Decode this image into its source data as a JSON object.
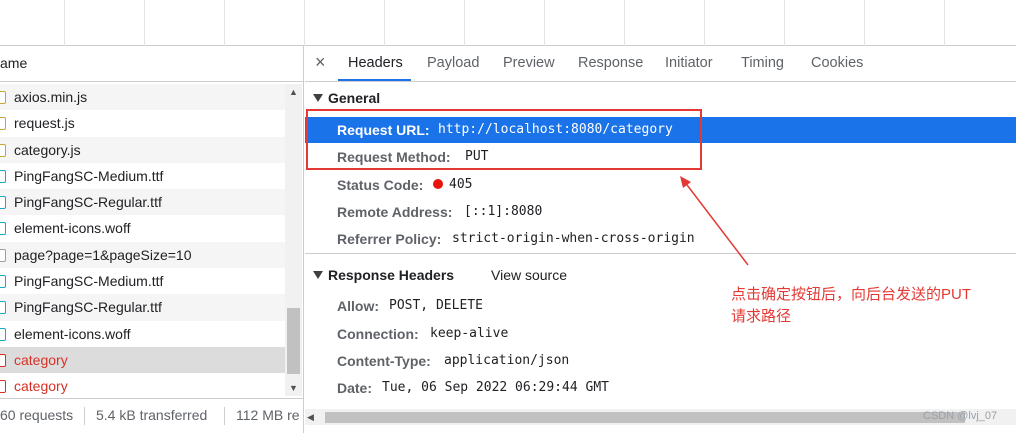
{
  "left": {
    "column_header": "ame",
    "files": [
      {
        "name": "axios.min.js",
        "type": "script",
        "error": false
      },
      {
        "name": "request.js",
        "type": "script",
        "error": false
      },
      {
        "name": "category.js",
        "type": "script",
        "error": false
      },
      {
        "name": "PingFangSC-Medium.ttf",
        "type": "font",
        "error": false
      },
      {
        "name": "PingFangSC-Regular.ttf",
        "type": "font",
        "error": false
      },
      {
        "name": "element-icons.woff",
        "type": "font",
        "error": false
      },
      {
        "name": "page?page=1&pageSize=10",
        "type": "doc",
        "error": false
      },
      {
        "name": "PingFangSC-Medium.ttf",
        "type": "font",
        "error": false
      },
      {
        "name": "PingFangSC-Regular.ttf",
        "type": "font",
        "error": false
      },
      {
        "name": "element-icons.woff",
        "type": "font",
        "error": false
      },
      {
        "name": "category",
        "type": "xhr",
        "error": true
      },
      {
        "name": "category",
        "type": "xhr",
        "error": true
      }
    ],
    "status": {
      "requests": "60 requests",
      "transferred": "5.4 kB transferred",
      "resources": "112 MB re"
    }
  },
  "tabs": [
    {
      "label": "Headers",
      "active": true
    },
    {
      "label": "Payload",
      "active": false
    },
    {
      "label": "Preview",
      "active": false
    },
    {
      "label": "Response",
      "active": false
    },
    {
      "label": "Initiator",
      "active": false
    },
    {
      "label": "Timing",
      "active": false
    },
    {
      "label": "Cookies",
      "active": false
    }
  ],
  "close_symbol": "×",
  "general": {
    "title": "General",
    "request_url_label": "Request URL:",
    "request_url": "http://localhost:8080/category",
    "request_method_label": "Request Method:",
    "request_method": "PUT",
    "status_code_label": "Status Code:",
    "status_code": "405",
    "remote_address_label": "Remote Address:",
    "remote_address": "[::1]:8080",
    "referrer_policy_label": "Referrer Policy:",
    "referrer_policy": "strict-origin-when-cross-origin"
  },
  "response_headers": {
    "title": "Response Headers",
    "view_source": "View source",
    "allow_label": "Allow:",
    "allow": "POST, DELETE",
    "connection_label": "Connection:",
    "connection": "keep-alive",
    "content_type_label": "Content-Type:",
    "content_type": "application/json",
    "date_label": "Date:",
    "date": "Tue, 06 Sep 2022 06:29:44 GMT"
  },
  "annotation": {
    "text_line1": "点击确定按钮后，向后台发送的PUT",
    "text_line2": "请求路径"
  },
  "watermark": "CSDN @lvj_07",
  "colors": {
    "accent": "#1a73e8",
    "error": "#d93025",
    "annotation": "#e53935"
  }
}
